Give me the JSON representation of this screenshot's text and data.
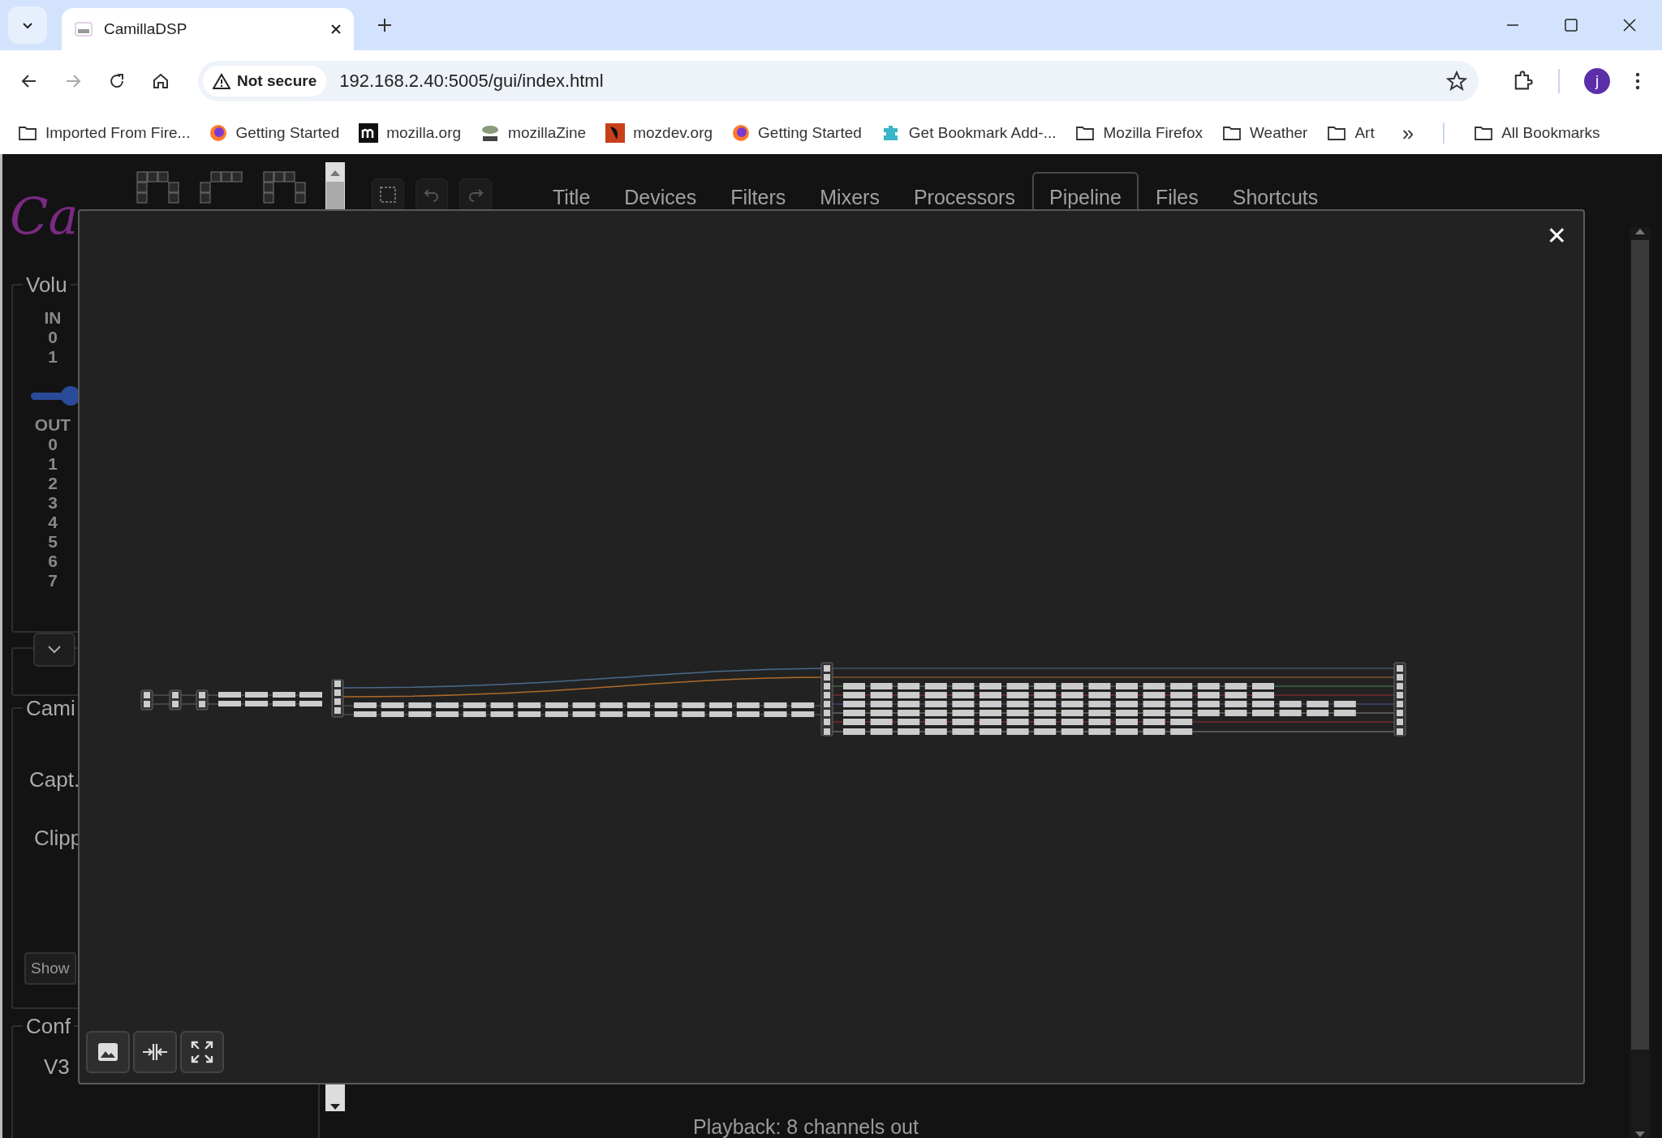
{
  "browser": {
    "tab_title": "CamillaDSP",
    "security": "Not secure",
    "url": "192.168.2.40:5005/gui/index.html",
    "profile_initial": "j",
    "bookmarks": [
      {
        "label": "Imported From Fire...",
        "kind": "folder"
      },
      {
        "label": "Getting Started",
        "kind": "firefox"
      },
      {
        "label": "mozilla.org",
        "kind": "mozilla"
      },
      {
        "label": "mozillaZine",
        "kind": "zine"
      },
      {
        "label": "mozdev.org",
        "kind": "mozdev"
      },
      {
        "label": "Getting Started",
        "kind": "firefox"
      },
      {
        "label": "Get Bookmark Add-...",
        "kind": "puzzle"
      },
      {
        "label": "Mozilla Firefox",
        "kind": "folder"
      },
      {
        "label": "Weather",
        "kind": "folder"
      },
      {
        "label": "Art",
        "kind": "folder"
      }
    ],
    "more": "»",
    "all_bookmarks": "All Bookmarks"
  },
  "app": {
    "logo_text": "Ca",
    "tabs": [
      {
        "label": "Title",
        "selected": false
      },
      {
        "label": "Devices",
        "selected": false
      },
      {
        "label": "Filters",
        "selected": false
      },
      {
        "label": "Mixers",
        "selected": false
      },
      {
        "label": "Processors",
        "selected": false
      },
      {
        "label": "Pipeline",
        "selected": true
      },
      {
        "label": "Files",
        "selected": false
      },
      {
        "label": "Shortcuts",
        "selected": false
      }
    ],
    "sidebar": {
      "volume_legend": "Volu",
      "in_label": "IN",
      "in_channels": [
        "0",
        "1"
      ],
      "volume": {
        "level": 0.85
      },
      "out_label": "OUT",
      "out_channels": [
        "0",
        "1",
        "2",
        "3",
        "4",
        "5",
        "6",
        "7"
      ],
      "camilla_legend": "Cami",
      "capture_label": "Capt.",
      "clipped_label": "Clipp",
      "show_button": "Show",
      "config_legend": "Conf",
      "config_name": "V3"
    },
    "status": "Playback: 8 channels out"
  },
  "modal": {
    "close": "✕"
  }
}
